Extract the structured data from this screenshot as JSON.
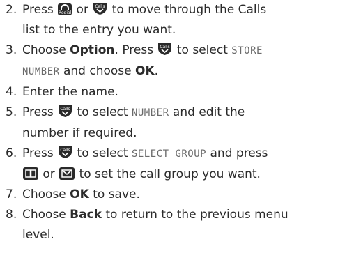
{
  "steps": [
    {
      "num": "2.",
      "line1_a": "Press ",
      "line1_b": " or ",
      "line1_c": " to move through the Calls",
      "line2": "list to the entry you want."
    },
    {
      "num": "3.",
      "line1_a": "Choose ",
      "option": "Option",
      "line1_b": ". Press ",
      "line1_c": " to select ",
      "lcd1": "STORE",
      "lcd2": "NUMBER",
      "line2_a": " and choose ",
      "ok": "OK",
      "line2_b": "."
    },
    {
      "num": "4.",
      "text": "Enter the name."
    },
    {
      "num": "5.",
      "line1_a": "Press ",
      "line1_b": " to select ",
      "lcd": "NUMBER",
      "line1_c": " and edit the",
      "line2": "number if required."
    },
    {
      "num": "6.",
      "line1_a": "Press ",
      "line1_b": " to select ",
      "lcd": "SELECT GROUP",
      "line1_c": " and press",
      "line2_a": " or ",
      "line2_b": " to set the call group you want."
    },
    {
      "num": "7.",
      "text_a": "Choose ",
      "ok": "OK",
      "text_b": " to save."
    },
    {
      "num": "8.",
      "text_a": "Choose ",
      "back": "Back",
      "text_b": " to return to the previous menu",
      "line2": "level."
    }
  ],
  "keys": {
    "redial_label": "Redial",
    "calls_label": "Calls"
  },
  "icons": {
    "redial": "redial-key-icon",
    "calls": "calls-key-icon",
    "phonebook": "phonebook-key-icon",
    "message": "message-key-icon"
  }
}
